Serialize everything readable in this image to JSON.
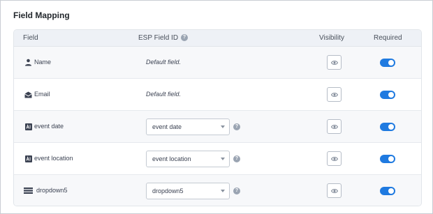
{
  "section": {
    "title": "Field Mapping"
  },
  "columns": {
    "field": "Field",
    "esp_field_id": "ESP Field ID",
    "esp_help": "?",
    "visibility": "Visibility",
    "required": "Required"
  },
  "colors": {
    "toggle_on": "#1f7ae0",
    "header_bg": "#eef1f6",
    "help_icon": "#9aa4b2"
  },
  "rows": [
    {
      "icon": "person-icon",
      "label": "Name",
      "esp": "Default field.",
      "esp_type": "static",
      "visible": true,
      "required": true
    },
    {
      "icon": "envelope-icon",
      "label": "Email",
      "esp": "Default field.",
      "esp_type": "static",
      "visible": true,
      "required": true
    },
    {
      "icon": "text-field-icon",
      "label": "event date",
      "esp": "event date",
      "esp_type": "select",
      "help": "?",
      "visible": true,
      "required": true
    },
    {
      "icon": "text-field-icon",
      "label": "event location",
      "esp": "event location",
      "esp_type": "select",
      "help": "?",
      "visible": true,
      "required": true
    },
    {
      "icon": "dropdown-field-icon",
      "label": "dropdown5",
      "esp": "dropdown5",
      "esp_type": "select",
      "help": "?",
      "visible": true,
      "required": true
    }
  ]
}
